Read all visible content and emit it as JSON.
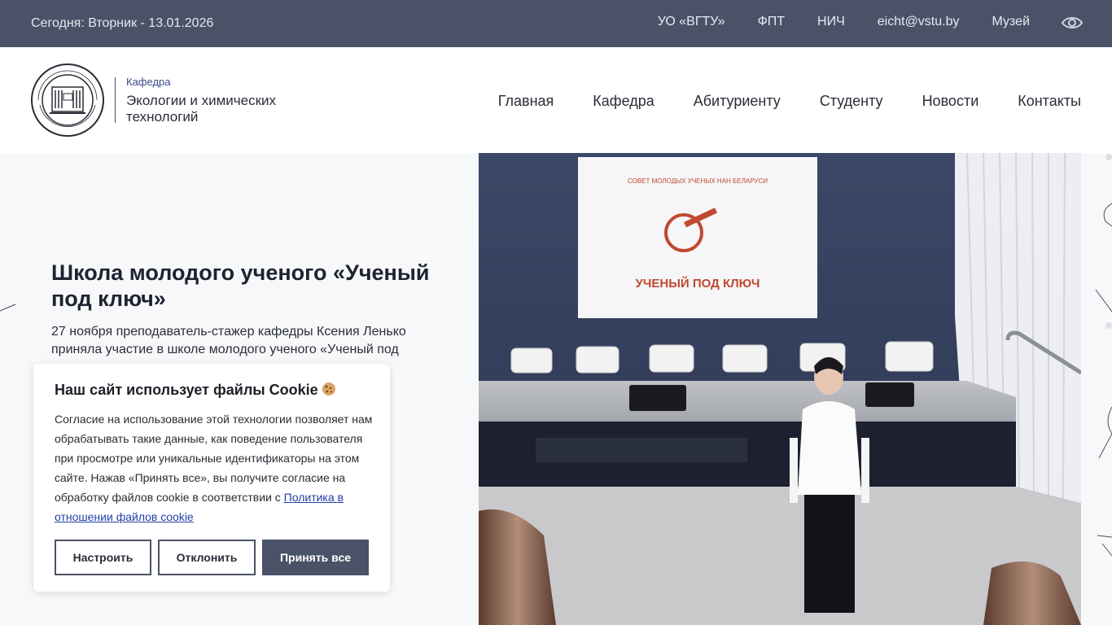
{
  "topbar": {
    "date": "Сегодня: Вторник - 13.01.2026",
    "links": [
      "УО «ВГТУ»",
      "ФПТ",
      "НИЧ",
      "eicht@vstu.by",
      "Музей"
    ]
  },
  "header": {
    "kicker": "Кафедра",
    "name": "Экологии и химических технологий",
    "nav": [
      "Главная",
      "Кафедра",
      "Абитуриенту",
      "Студенту",
      "Новости",
      "Контакты"
    ]
  },
  "hero": {
    "title": "Школа молодого ученого «Ученый под ключ»",
    "text": "27 ноября преподаватель-стажер кафедры Ксения Ленько приняла участие в школе молодого ученого «Ученый под",
    "screen_top": "СОВЕТ МОЛОДЫХ УЧЕНЫХ НАН БЕЛАРУСИ",
    "screen_main": "УЧЕНЫЙ ПОД КЛЮЧ"
  },
  "cookie": {
    "title": "Наш сайт использует файлы Cookie",
    "body": "Согласие на использование этой технологии позволяет нам обрабатывать такие данные, как поведение пользователя при просмотре или уникальные идентификаторы на этом сайте. Нажав «Принять все», вы получите согласие на обработку файлов cookie в соответствии с",
    "policy_link": "Политика в отношении файлов cookie",
    "buttons": {
      "settings": "Настроить",
      "decline": "Отклонить",
      "accept": "Принять все"
    }
  },
  "colors": {
    "topbar": "#4a5268",
    "accent_link": "#1f3fa8",
    "page_bg": "#f7f8fa"
  }
}
